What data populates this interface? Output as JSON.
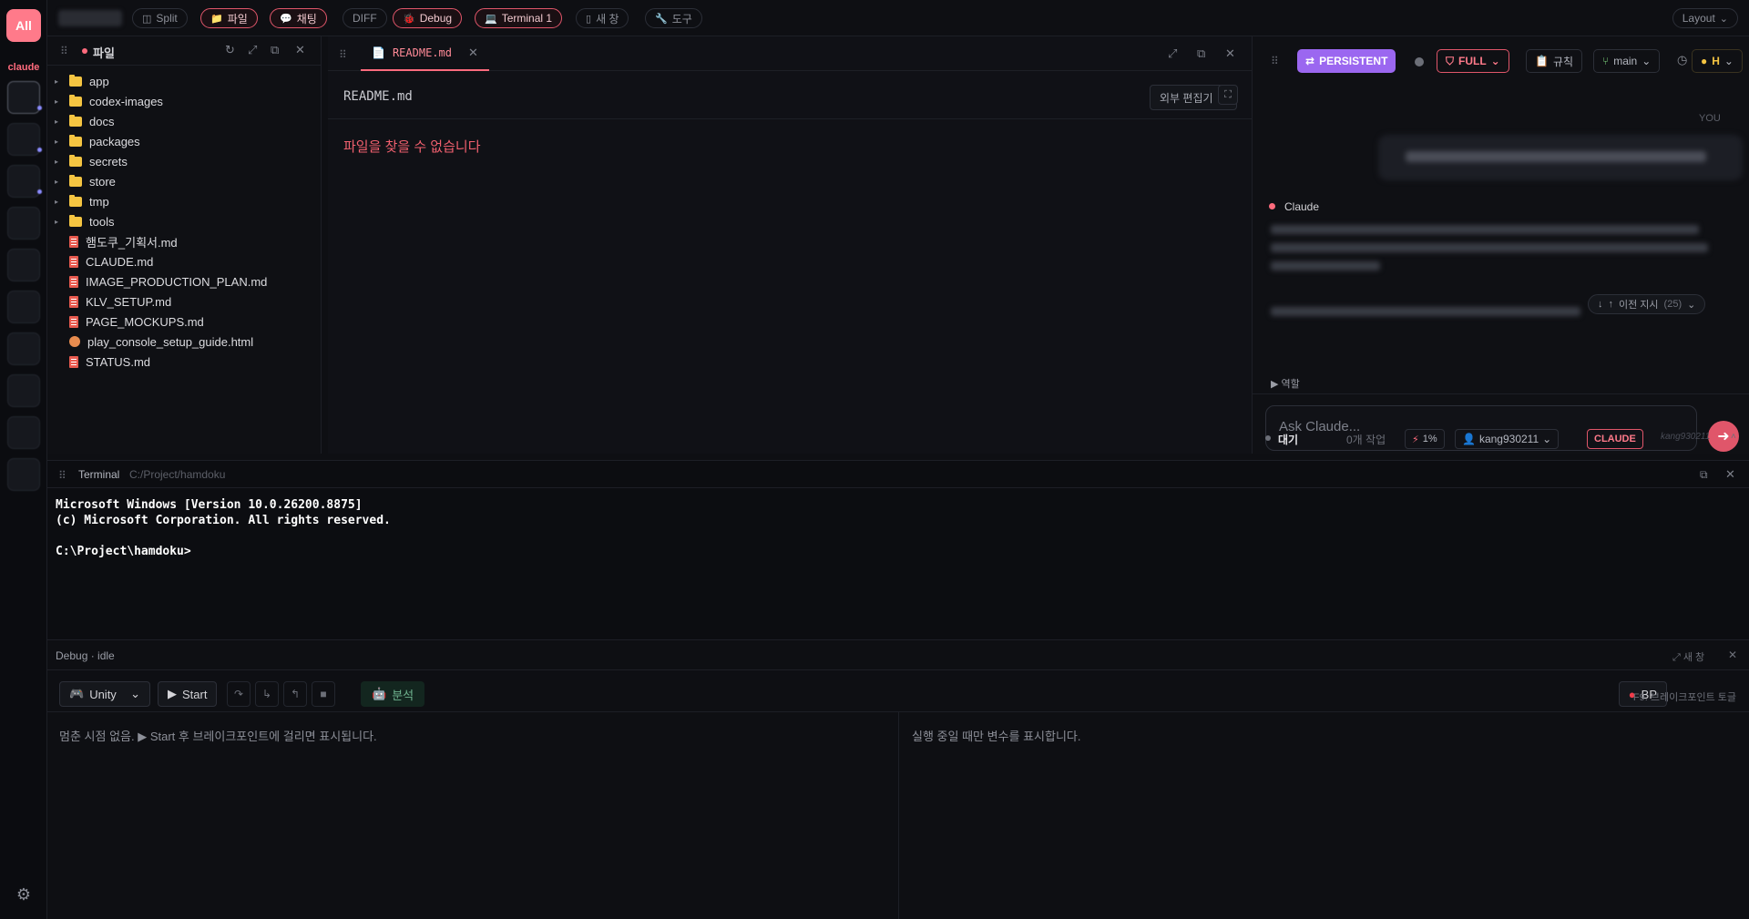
{
  "rail": {
    "all_label": "All",
    "section_label": "claude",
    "settings_icon": "gear-icon"
  },
  "topbar": {
    "split_label": "Split",
    "file_label": "파일",
    "chat_label": "채팅",
    "diff_label": "DIFF",
    "debug_label": "Debug",
    "terminal_label": "Terminal 1",
    "new_window_label": "새 창",
    "tools_label": "도구",
    "layout_label": "Layout"
  },
  "files": {
    "title": "파일",
    "items": [
      {
        "name": "app",
        "type": "folder"
      },
      {
        "name": "codex-images",
        "type": "folder"
      },
      {
        "name": "docs",
        "type": "folder"
      },
      {
        "name": "packages",
        "type": "folder"
      },
      {
        "name": "secrets",
        "type": "folder"
      },
      {
        "name": "store",
        "type": "folder"
      },
      {
        "name": "tmp",
        "type": "folder"
      },
      {
        "name": "tools",
        "type": "folder"
      },
      {
        "name": "햄도쿠_기획서.md",
        "type": "md"
      },
      {
        "name": "CLAUDE.md",
        "type": "md"
      },
      {
        "name": "IMAGE_PRODUCTION_PLAN.md",
        "type": "md"
      },
      {
        "name": "KLV_SETUP.md",
        "type": "md"
      },
      {
        "name": "PAGE_MOCKUPS.md",
        "type": "md"
      },
      {
        "name": "play_console_setup_guide.html",
        "type": "html"
      },
      {
        "name": "STATUS.md",
        "type": "md"
      }
    ]
  },
  "editor": {
    "tab_label": "README.md",
    "file_path": "README.md",
    "external_edit_label": "외부 편집기",
    "error_message": "파일을 찾을 수 없습니다"
  },
  "chat": {
    "persistent_label": "PERSISTENT",
    "full_label": "FULL",
    "rules_label": "규칙",
    "branch_label": "main",
    "model_label": "H",
    "you_label": "YOU",
    "assistant_name": "Claude",
    "prev_hint_label": "이전 지시",
    "prev_hint_count": "(25)",
    "role_label": "역할",
    "input_placeholder": "Ask Claude...",
    "status": {
      "state": "대기",
      "jobs": "0개 작업",
      "usage": "1%",
      "user": "kang930211",
      "provider": "CLAUDE",
      "user_faint": "kang930211"
    }
  },
  "terminal": {
    "title": "Terminal",
    "path": "C:/Project/hamdoku",
    "output": "Microsoft Windows [Version 10.0.26200.8875]\n(c) Microsoft Corporation. All rights reserved.\n\nC:\\Project\\hamdoku>"
  },
  "debug": {
    "title": "Debug · idle",
    "new_window_label": "새 창",
    "engine_select": "Unity",
    "start_label": "Start",
    "analyze_label": "분석",
    "bp_label": "BP",
    "bp_hint": "F9: 브레이크포인트 토글",
    "stack_message": "멈춘 시점 없음. ▶ Start 후 브레이크포인트에 걸리면 표시됩니다.",
    "vars_message": "실행 중일 때만 변수를 표시합니다."
  },
  "colors": {
    "accent": "#ff6b7d",
    "persistent": "#9b67f0",
    "background": "#0e0f13",
    "terminal_text": "#ffffff"
  }
}
